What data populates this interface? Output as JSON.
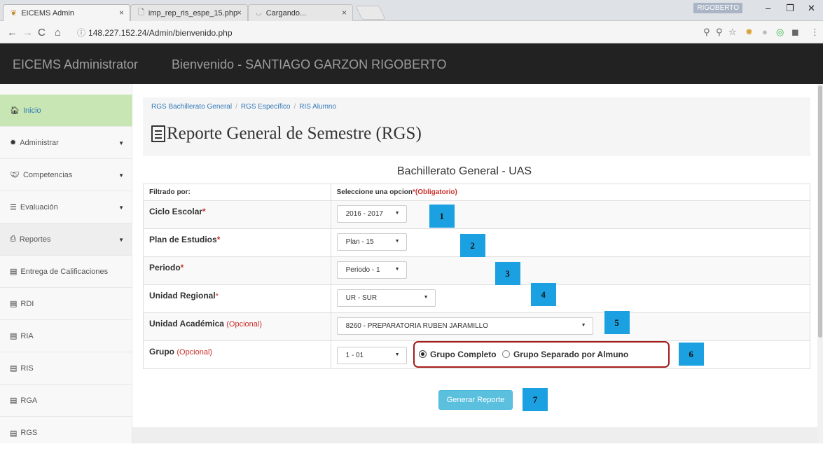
{
  "browser": {
    "tabs": [
      {
        "title": "EICEMS Admin",
        "icon": "site-favicon"
      },
      {
        "title": "imp_rep_ris_espe_15.php",
        "icon": "page-icon"
      },
      {
        "title": "Cargando...",
        "icon": "loading-icon"
      }
    ],
    "close": "×",
    "user": "RIGOBERTO",
    "url": "148.227.152.24/Admin/bienvenido.php"
  },
  "app": {
    "brand": "EICEMS Administrator",
    "welcome": "Bienvenido - SANTIAGO GARZON RIGOBERTO"
  },
  "sidebar": {
    "items": [
      {
        "label": "Inicio",
        "icon": "home-icon",
        "caret": false
      },
      {
        "label": "Administrar",
        "icon": "gear-icon",
        "caret": true
      },
      {
        "label": "Competencias",
        "icon": "handshake-icon",
        "caret": true
      },
      {
        "label": "Evaluación",
        "icon": "list-icon",
        "caret": true
      },
      {
        "label": "Reportes",
        "icon": "print-icon",
        "caret": true
      },
      {
        "label": "Entrega de Calificaciones",
        "icon": "document-icon",
        "caret": false
      },
      {
        "label": "RDI",
        "icon": "document-icon",
        "caret": false
      },
      {
        "label": "RIA",
        "icon": "document-icon",
        "caret": false
      },
      {
        "label": "RIS",
        "icon": "document-icon",
        "caret": false
      },
      {
        "label": "RGA",
        "icon": "document-icon",
        "caret": false
      },
      {
        "label": "RGS",
        "icon": "document-icon",
        "caret": false
      }
    ]
  },
  "breadcrumb": [
    "RGS Bachillerato General",
    "RGS Específico",
    "RIS Alumno"
  ],
  "page_title": "Reporte General de Semestre (RGS)",
  "subtitle": "Bachillerato General - UAS",
  "form": {
    "header_left": "Filtrado por:",
    "header_right": "Seleccione una opcion",
    "header_required": "*(Obligatorio)",
    "rows": [
      {
        "label": "Ciclo Escolar",
        "flag": "*",
        "value": "2016 - 2017",
        "badge": "1"
      },
      {
        "label": "Plan de Estudios",
        "flag": "*",
        "value": "Plan - 15",
        "badge": "2"
      },
      {
        "label": "Periodo",
        "flag": "*",
        "value": "Periodo - 1",
        "badge": "3"
      },
      {
        "label": "Unidad Regional",
        "flag": "*",
        "value": "UR - SUR",
        "badge": "4"
      },
      {
        "label": "Unidad Académica",
        "flag": "(Opcional)",
        "value": "8260 - PREPARATORIA RUBEN JARAMILLO",
        "badge": "5"
      },
      {
        "label": "Grupo",
        "flag": "(Opcional)",
        "value": "1 - 01",
        "badge": "6"
      }
    ],
    "radio_full": "Grupo Completo",
    "radio_separate": "Grupo Separado por Almuno"
  },
  "generate_button": "Generar Reporte",
  "generate_badge": "7"
}
